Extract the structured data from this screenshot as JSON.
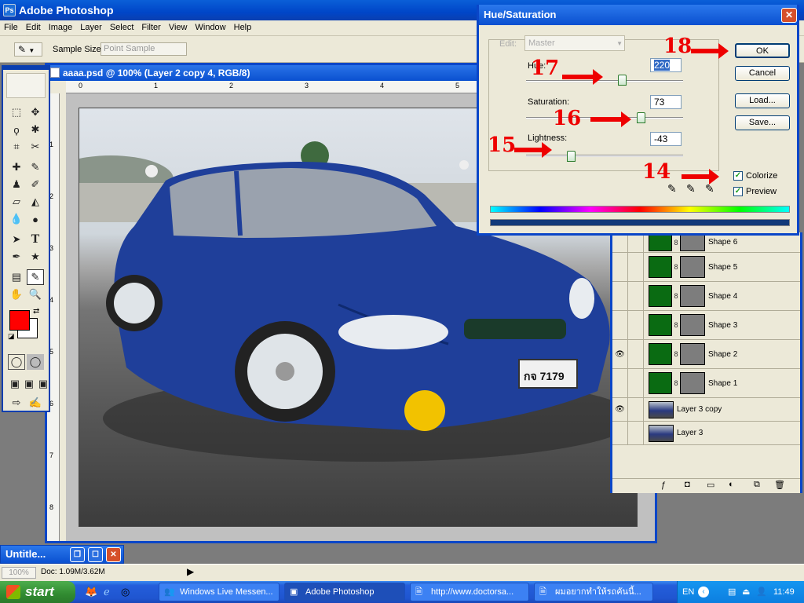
{
  "app": {
    "title": "Adobe Photoshop"
  },
  "menu": [
    "File",
    "Edit",
    "Image",
    "Layer",
    "Select",
    "Filter",
    "View",
    "Window",
    "Help"
  ],
  "options": {
    "sample_size_label": "Sample Size:",
    "sample_size_value": "Point Sample"
  },
  "document": {
    "title": "aaaa.psd @ 100% (Layer 2 copy 4, RGB/8)",
    "ruler_h": [
      "0",
      "1",
      "2",
      "3",
      "4",
      "5",
      "6"
    ],
    "ruler_v": [
      "1",
      "2",
      "3",
      "4",
      "5",
      "6",
      "7",
      "8"
    ],
    "plate": "กจ 7179"
  },
  "colors": {
    "foreground": "#ff0000",
    "background": "#ffffff",
    "car": "#1f3f9a"
  },
  "dialog": {
    "title": "Hue/Saturation",
    "edit_label": "Edit:",
    "edit_value": "Master",
    "hue_label": "Hue:",
    "hue_value": "220",
    "saturation_label": "Saturation:",
    "saturation_value": "73",
    "lightness_label": "Lightness:",
    "lightness_value": "-43",
    "ok": "OK",
    "cancel": "Cancel",
    "load": "Load...",
    "save": "Save...",
    "colorize": "Colorize",
    "preview": "Preview",
    "colorize_checked": true,
    "preview_checked": true
  },
  "annotations": [
    "18",
    "17",
    "16",
    "15",
    "14"
  ],
  "layers": [
    {
      "name": "Shape 6",
      "type": "shape",
      "visible": false
    },
    {
      "name": "Shape 5",
      "type": "shape",
      "visible": false
    },
    {
      "name": "Shape 4",
      "type": "shape",
      "visible": false
    },
    {
      "name": "Shape 3",
      "type": "shape",
      "visible": false
    },
    {
      "name": "Shape 2",
      "type": "shape",
      "visible": true
    },
    {
      "name": "Shape 1",
      "type": "shape",
      "visible": false
    },
    {
      "name": "Layer 3 copy",
      "type": "pixel",
      "visible": true
    },
    {
      "name": "Layer 3",
      "type": "pixel",
      "visible": false
    }
  ],
  "status": {
    "zoom": "100%",
    "doc": "Doc: 1.09M/3.62M"
  },
  "minimized": {
    "title": "Untitle..."
  },
  "taskbar": {
    "start": "start",
    "items": [
      "Windows Live Messen...",
      "Adobe Photoshop",
      "http://www.doctorsa...",
      "ผมอยากทำให้รถคันนี้..."
    ],
    "lang": "EN",
    "time": "11:49"
  }
}
